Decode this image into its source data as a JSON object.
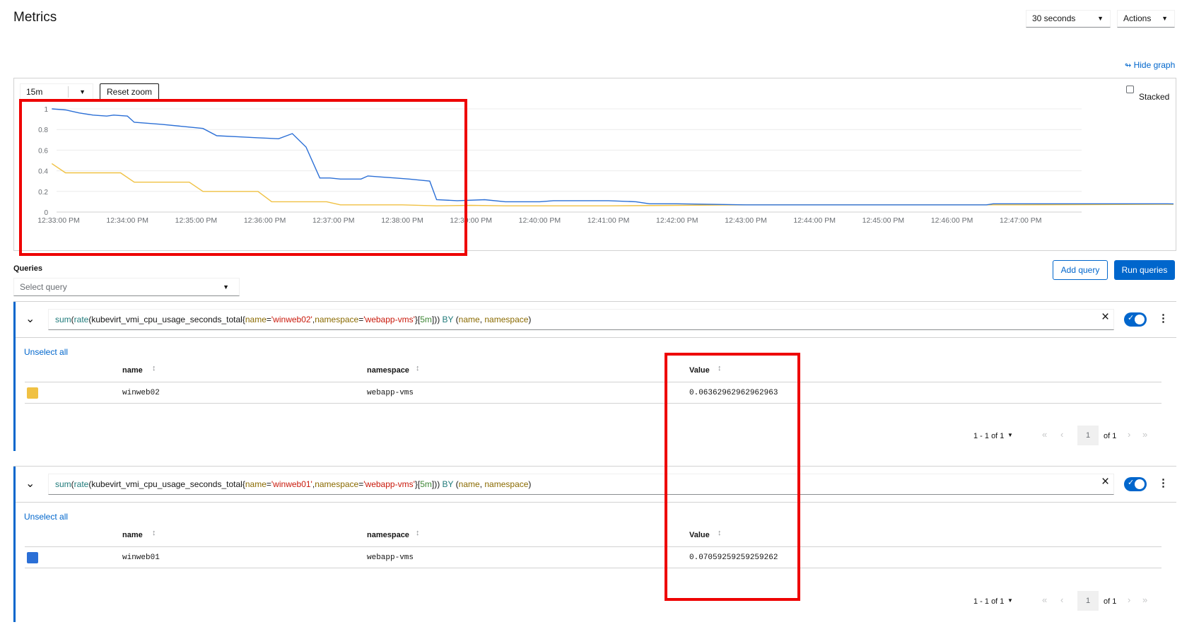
{
  "header": {
    "title": "Metrics",
    "refresh_interval": "30 seconds",
    "actions_label": "Actions"
  },
  "graph": {
    "hide_graph_label": "Hide graph",
    "time_range": "15m",
    "reset_zoom_label": "Reset zoom",
    "stacked_label": "Stacked",
    "stacked_checked": false
  },
  "queries": {
    "section_title": "Queries",
    "select_placeholder": "Select query",
    "add_query_label": "Add query",
    "run_queries_label": "Run queries",
    "items": [
      {
        "expression": "sum(rate(kubevirt_vmi_cpu_usage_seconds_total{name='winweb02',namespace='webapp-vms'}[5m])) BY (name, namespace)",
        "tokens": [
          {
            "t": "sum",
            "c": "t-fn"
          },
          {
            "t": "(",
            "c": "t-punc"
          },
          {
            "t": "rate",
            "c": "t-fn"
          },
          {
            "t": "(",
            "c": "t-punc"
          },
          {
            "t": "kubevirt_vmi_cpu_usage_seconds_total",
            "c": "t-metric"
          },
          {
            "t": "{",
            "c": "t-punc"
          },
          {
            "t": "name",
            "c": "t-label"
          },
          {
            "t": "=",
            "c": "t-punc"
          },
          {
            "t": "'winweb02'",
            "c": "t-str"
          },
          {
            "t": ",",
            "c": "t-punc"
          },
          {
            "t": "namespace",
            "c": "t-label"
          },
          {
            "t": "=",
            "c": "t-punc"
          },
          {
            "t": "'webapp-vms'",
            "c": "t-str"
          },
          {
            "t": "}[",
            "c": "t-punc"
          },
          {
            "t": "5m",
            "c": "t-num"
          },
          {
            "t": "]))",
            "c": "t-punc"
          },
          {
            "t": " BY ",
            "c": "t-kw"
          },
          {
            "t": "(",
            "c": "t-punc"
          },
          {
            "t": "name",
            "c": "t-label"
          },
          {
            "t": ", ",
            "c": "t-punc"
          },
          {
            "t": "namespace",
            "c": "t-label"
          },
          {
            "t": ")",
            "c": "t-punc"
          }
        ],
        "enabled": true,
        "unselect_all_label": "Unselect all",
        "columns": [
          "name",
          "namespace",
          "Value"
        ],
        "rows": [
          {
            "color": "#f0c143",
            "name": "winweb02",
            "namespace": "webapp-vms",
            "value": "0.06362962962962963"
          }
        ],
        "pagination": {
          "range": "1 - 1 of 1",
          "page": "1",
          "of_label": "of 1"
        }
      },
      {
        "expression": "sum(rate(kubevirt_vmi_cpu_usage_seconds_total{name='winweb01',namespace='webapp-vms'}[5m])) BY (name, namespace)",
        "tokens": [
          {
            "t": "sum",
            "c": "t-fn"
          },
          {
            "t": "(",
            "c": "t-punc"
          },
          {
            "t": "rate",
            "c": "t-fn"
          },
          {
            "t": "(",
            "c": "t-punc"
          },
          {
            "t": "kubevirt_vmi_cpu_usage_seconds_total",
            "c": "t-metric"
          },
          {
            "t": "{",
            "c": "t-punc"
          },
          {
            "t": "name",
            "c": "t-label"
          },
          {
            "t": "=",
            "c": "t-punc"
          },
          {
            "t": "'winweb01'",
            "c": "t-str"
          },
          {
            "t": ",",
            "c": "t-punc"
          },
          {
            "t": "namespace",
            "c": "t-label"
          },
          {
            "t": "=",
            "c": "t-punc"
          },
          {
            "t": "'webapp-vms'",
            "c": "t-str"
          },
          {
            "t": "}[",
            "c": "t-punc"
          },
          {
            "t": "5m",
            "c": "t-num"
          },
          {
            "t": "]))",
            "c": "t-punc"
          },
          {
            "t": " BY ",
            "c": "t-kw"
          },
          {
            "t": "(",
            "c": "t-punc"
          },
          {
            "t": "name",
            "c": "t-label"
          },
          {
            "t": ", ",
            "c": "t-punc"
          },
          {
            "t": "namespace",
            "c": "t-label"
          },
          {
            "t": ")",
            "c": "t-punc"
          }
        ],
        "enabled": true,
        "unselect_all_label": "Unselect all",
        "columns": [
          "name",
          "namespace",
          "Value"
        ],
        "rows": [
          {
            "color": "#2b6fd6",
            "name": "winweb01",
            "namespace": "webapp-vms",
            "value": "0.07059259259259262"
          }
        ],
        "pagination": {
          "range": "1 - 1 of 1",
          "page": "1",
          "of_label": "of 1"
        }
      }
    ]
  },
  "icons": {
    "dropdown": "caret-down-icon",
    "hide_graph": "compress-icon",
    "expand": "chevron-down-icon",
    "clear": "close-icon",
    "menu": "kebab-icon",
    "first": "angle-double-left-icon",
    "prev": "angle-left-icon",
    "next": "angle-right-icon",
    "last": "angle-double-right-icon"
  },
  "colors": {
    "accent": "#0066cc",
    "series_winweb02": "#f0c143",
    "series_winweb01": "#2b6fd6",
    "highlight": "#ee0000"
  },
  "chart_data": {
    "type": "line",
    "xlabel": "",
    "ylabel": "",
    "ylim": [
      0,
      1
    ],
    "yticks": [
      "0",
      "0.2",
      "0.4",
      "0.6",
      "0.8",
      "1"
    ],
    "xticks": [
      "12:33:00 PM",
      "12:34:00 PM",
      "12:35:00 PM",
      "12:36:00 PM",
      "12:37:00 PM",
      "12:38:00 PM",
      "12:39:00 PM",
      "12:40:00 PM",
      "12:41:00 PM",
      "12:42:00 PM",
      "12:43:00 PM",
      "12:44:00 PM",
      "12:45:00 PM",
      "12:46:00 PM",
      "12:47:00 PM"
    ],
    "grid": true,
    "x_unit": "minutes after 12:33:00 PM",
    "series": [
      {
        "name": "winweb01",
        "color": "#2b6fd6",
        "points": [
          [
            -0.1,
            1.0
          ],
          [
            0.1,
            0.99
          ],
          [
            0.3,
            0.96
          ],
          [
            0.5,
            0.94
          ],
          [
            0.7,
            0.93
          ],
          [
            0.8,
            0.94
          ],
          [
            1.0,
            0.93
          ],
          [
            1.1,
            0.87
          ],
          [
            1.3,
            0.86
          ],
          [
            1.5,
            0.85
          ],
          [
            1.8,
            0.83
          ],
          [
            2.1,
            0.81
          ],
          [
            2.3,
            0.74
          ],
          [
            2.6,
            0.73
          ],
          [
            2.9,
            0.72
          ],
          [
            3.2,
            0.71
          ],
          [
            3.4,
            0.76
          ],
          [
            3.6,
            0.63
          ],
          [
            3.8,
            0.33
          ],
          [
            3.95,
            0.33
          ],
          [
            4.1,
            0.32
          ],
          [
            4.4,
            0.32
          ],
          [
            4.5,
            0.35
          ],
          [
            4.7,
            0.34
          ],
          [
            4.9,
            0.33
          ],
          [
            5.1,
            0.32
          ],
          [
            5.4,
            0.3
          ],
          [
            5.5,
            0.12
          ],
          [
            5.8,
            0.11
          ],
          [
            6.2,
            0.12
          ],
          [
            6.5,
            0.1
          ],
          [
            7.0,
            0.1
          ],
          [
            7.2,
            0.11
          ],
          [
            7.5,
            0.11
          ],
          [
            8.0,
            0.11
          ],
          [
            8.4,
            0.1
          ],
          [
            8.6,
            0.08
          ],
          [
            9.0,
            0.08
          ],
          [
            10.0,
            0.07
          ],
          [
            12.0,
            0.07
          ],
          [
            13.5,
            0.07
          ],
          [
            13.6,
            0.08
          ],
          [
            14.5,
            0.08
          ],
          [
            16.0,
            0.08
          ],
          [
            18.0,
            0.075
          ],
          [
            20.0,
            0.07
          ],
          [
            22.0,
            0.07
          ],
          [
            24.0,
            0.07
          ],
          [
            26.0,
            0.08
          ]
        ]
      },
      {
        "name": "winweb02",
        "color": "#f0c143",
        "points": [
          [
            -0.1,
            0.47
          ],
          [
            0.1,
            0.38
          ],
          [
            0.5,
            0.38
          ],
          [
            0.9,
            0.38
          ],
          [
            1.1,
            0.29
          ],
          [
            1.5,
            0.29
          ],
          [
            1.9,
            0.29
          ],
          [
            2.1,
            0.2
          ],
          [
            2.5,
            0.2
          ],
          [
            2.9,
            0.2
          ],
          [
            3.1,
            0.1
          ],
          [
            3.5,
            0.1
          ],
          [
            3.9,
            0.1
          ],
          [
            4.1,
            0.07
          ],
          [
            4.5,
            0.07
          ],
          [
            5.0,
            0.07
          ],
          [
            5.5,
            0.06
          ],
          [
            6.0,
            0.065
          ],
          [
            6.5,
            0.06
          ],
          [
            7.0,
            0.06
          ],
          [
            8.0,
            0.06
          ],
          [
            9.0,
            0.065
          ],
          [
            10.0,
            0.07
          ],
          [
            12.0,
            0.07
          ],
          [
            14.0,
            0.07
          ],
          [
            16.0,
            0.075
          ],
          [
            18.0,
            0.075
          ],
          [
            20.0,
            0.07
          ],
          [
            22.0,
            0.07
          ],
          [
            24.0,
            0.065
          ],
          [
            26.0,
            0.07
          ]
        ]
      }
    ]
  }
}
